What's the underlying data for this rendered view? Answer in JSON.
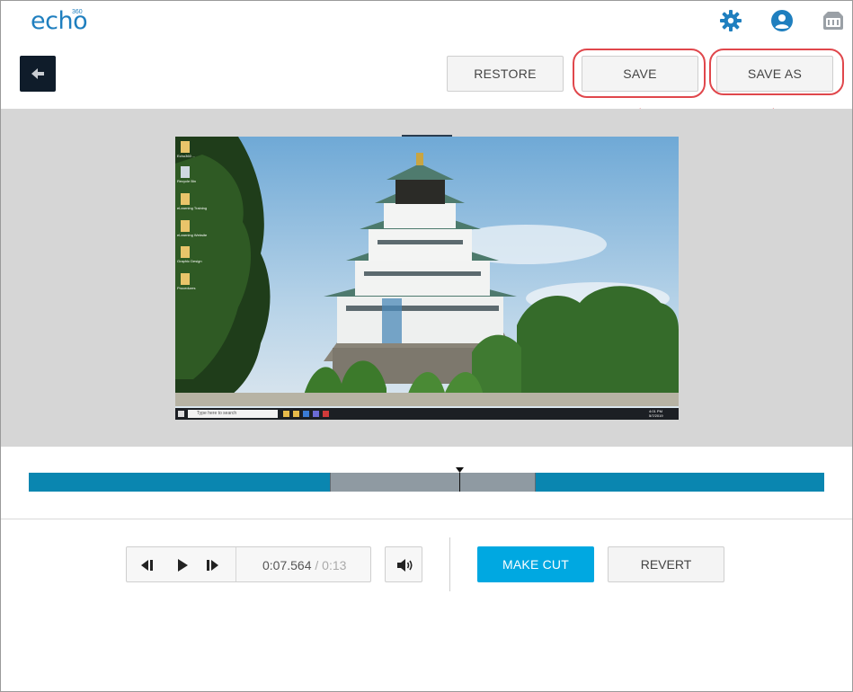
{
  "header": {
    "logo_text": "echo",
    "logo_sup": "360",
    "brand_color": "#1f7fbf",
    "icons": [
      "gear-icon",
      "user-account-icon",
      "tray-icon"
    ]
  },
  "toolbar": {
    "restore_label": "RESTORE",
    "save_label": "SAVE",
    "save_as_label": "SAVE AS"
  },
  "timeline": {
    "playhead_fraction": 0.54,
    "segments": [
      {
        "type": "kept",
        "color": "#0a86b0"
      },
      {
        "type": "cut",
        "color": "#8f9aa2"
      },
      {
        "type": "kept",
        "color": "#0a86b0"
      }
    ]
  },
  "controls": {
    "current_time": "0:07.564",
    "separator": "/",
    "duration": "0:13",
    "make_cut_label": "MAKE CUT",
    "revert_label": "REVERT",
    "accent_color": "#00a8e1"
  },
  "video": {
    "desktop_icons": [
      "Echo360 ...",
      "Recycle Bin",
      "eLearning Training",
      "eLearning Website",
      "Graphic Design",
      "Procedures"
    ],
    "search_placeholder": "Type here to search",
    "clock_time": "4:01 PM",
    "clock_date": "5/7/2019"
  }
}
